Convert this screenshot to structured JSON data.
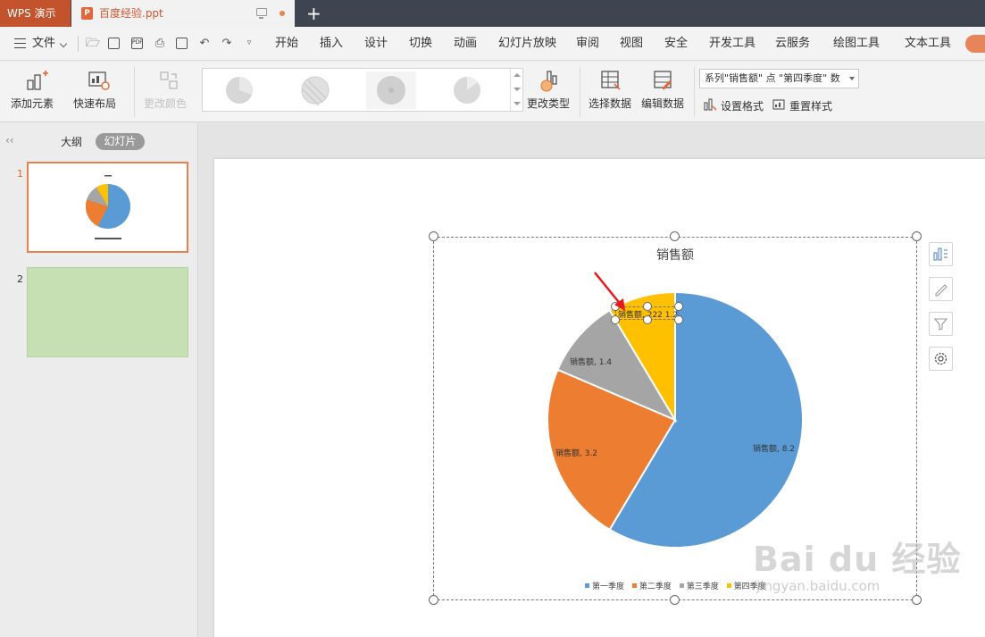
{
  "titlebar": {
    "app_tab": "WPS 演示",
    "doc_tab": "百度经验.ppt",
    "doc_icon_letter": "P"
  },
  "menubar": {
    "file_menu": "文件",
    "tabs": [
      "开始",
      "插入",
      "设计",
      "切换",
      "动画",
      "幻灯片放映",
      "审阅",
      "视图",
      "安全",
      "开发工具",
      "云服务",
      "绘图工具",
      "文本工具"
    ]
  },
  "ribbon": {
    "add_element": "添加元素",
    "quick_layout": "快速布局",
    "change_color": "更改颜色",
    "change_type": "更改类型",
    "select_data": "选择数据",
    "edit_data": "编辑数据",
    "series_select": "系列\"销售额\" 点 \"第四季度\" 数",
    "set_format": "设置格式",
    "reset_style": "重置样式"
  },
  "left_panel": {
    "outline_tab": "大纲",
    "slides_tab": "幻灯片",
    "slide_numbers": [
      "1",
      "2"
    ],
    "collapse_glyph": "‹‹"
  },
  "chart_data": {
    "type": "pie",
    "title": "销售额",
    "categories": [
      "第一季度",
      "第二季度",
      "第三季度",
      "第四季度"
    ],
    "values": [
      8.2,
      3.2,
      1.4,
      1.2
    ],
    "colors": [
      "#5b9bd5",
      "#ed7d31",
      "#a5a5a5",
      "#ffc000"
    ],
    "data_labels": [
      "销售额, 8.2",
      "销售额, 3.2",
      "销售额, 1.4",
      "销售额, 第四季度 1.2"
    ],
    "data_label_selected_text": "销售额, 222 1.2",
    "legend_position": "bottom",
    "selected_point": "第四季度"
  },
  "side_tools": [
    "chart-elements-icon",
    "chart-style-icon",
    "chart-filter-icon",
    "chart-settings-icon"
  ],
  "watermark": {
    "brand": "Bai du 经验",
    "url": "jingyan.baidu.com"
  },
  "accent_color": "#c3532c"
}
